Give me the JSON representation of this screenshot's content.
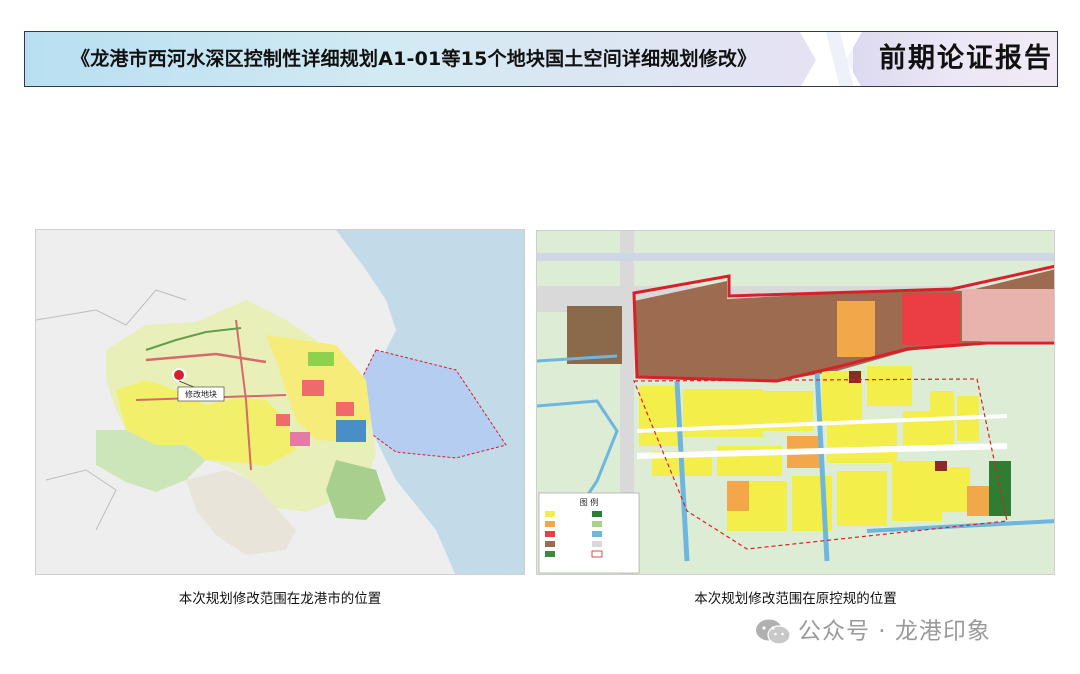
{
  "header": {
    "title": "《龙港市西河水深区控制性详细规划A1-01等15个地块国土空间详细规划修改》",
    "tag": "前期论证报告"
  },
  "map_left": {
    "marker_label": "修改地块",
    "caption": "本次规划修改范围在龙港市的位置"
  },
  "map_right": {
    "legend_title": "图 例",
    "caption": "本次规划修改范围在原控规的位置"
  },
  "watermark": {
    "icon": "wechat-icon",
    "text": "公众号 · 龙港印象"
  },
  "colors": {
    "boundary_red": "#d8202a",
    "residential_yellow": "#f4ee4a",
    "commercial_orange": "#f3a74b",
    "industrial_brown": "#8c5a3c",
    "green_space": "#3b8a3e",
    "water_blue": "#6fb6de"
  }
}
